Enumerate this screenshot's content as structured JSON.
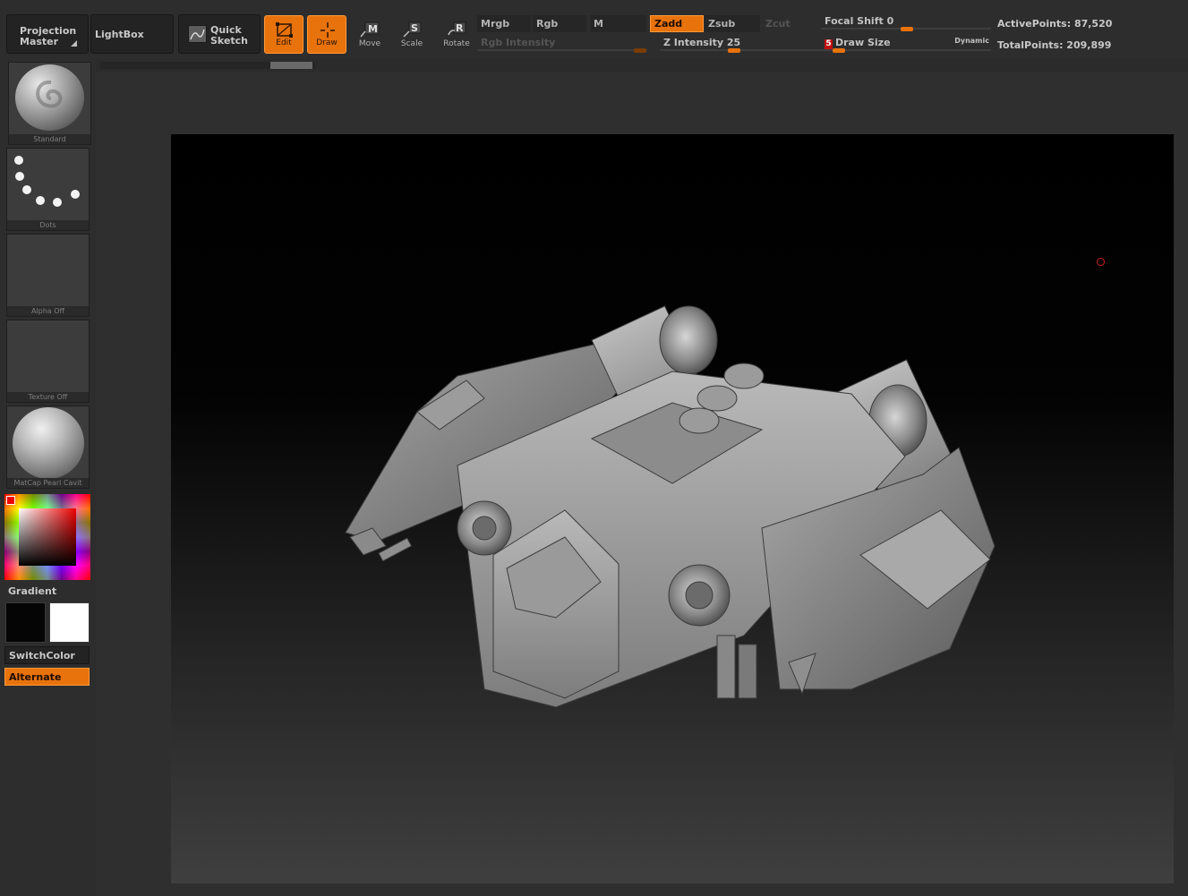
{
  "toolbar": {
    "projection_master": "Projection\nMaster",
    "lightbox": "LightBox",
    "quick_sketch": "Quick\nSketch",
    "modes": {
      "edit": "Edit",
      "draw": "Draw",
      "move": "Move",
      "scale": "Scale",
      "rotate": "Rotate"
    },
    "channels": {
      "mrgb": "Mrgb",
      "rgb": "Rgb",
      "m": "M",
      "zadd": "Zadd",
      "zsub": "Zsub",
      "zcut": "Zcut"
    },
    "rgb_intensity": "Rgb  Intensity",
    "z_intensity": "Z  Intensity 25",
    "focal_shift": "Focal  Shift 0",
    "draw_size_value": "5",
    "draw_size": "Draw  Size",
    "dynamic": "Dynamic",
    "active_points": "ActivePoints: 87,520",
    "total_points": "TotalPoints: 209,899"
  },
  "shelf": {
    "brush": "Standard",
    "stroke": "Dots",
    "alpha": "Alpha  Off",
    "texture": "Texture  Off",
    "material": "MatCap  Pearl  Cavit",
    "gradient": "Gradient",
    "switch_color": "SwitchColor",
    "alternate": "Alternate"
  },
  "colors": {
    "accent": "#e8720c",
    "main_color": "#050505",
    "secondary_color": "#ffffff"
  }
}
